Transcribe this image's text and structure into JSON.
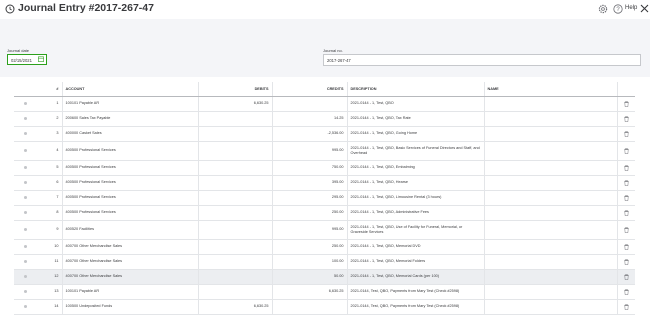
{
  "header": {
    "title": "Journal Entry #2017-267-47",
    "help_label": "Help"
  },
  "form": {
    "date_label": "Journal date",
    "date_value": "02/15/2021",
    "jno_label": "Journal no.",
    "jno_value": "2017-267-47"
  },
  "table": {
    "columns": [
      "#",
      "ACCOUNT",
      "DEBITS",
      "CREDITS",
      "DESCRIPTION",
      "NAME"
    ],
    "rows": [
      {
        "num": "1",
        "account": "100101 Payable AR",
        "debit": "6,630.25",
        "credit": "",
        "description": "2021-0144 - 1, Test, QBO",
        "name": ""
      },
      {
        "num": "2",
        "account": "200600 Sales Tax Payable",
        "debit": "",
        "credit": "14.25",
        "description": "2021-0144 - 1, Test, QBO, Tax Rate",
        "name": ""
      },
      {
        "num": "3",
        "account": "400000 Casket Sales",
        "debit": "",
        "credit": "-2,536.00",
        "description": "2021-0144 - 1, Test, QBO, Going Home",
        "name": ""
      },
      {
        "num": "4",
        "account": "400500 Professional Services",
        "debit": "",
        "credit": "995.00",
        "description": "2021-0144 - 1, Test, QBO, Basic Services of Funeral Directors and Staff, and Overhead",
        "name": ""
      },
      {
        "num": "5",
        "account": "400500 Professional Services",
        "debit": "",
        "credit": "750.00",
        "description": "2021-0144 - 1, Test, QBO, Embalming",
        "name": ""
      },
      {
        "num": "6",
        "account": "400500 Professional Services",
        "debit": "",
        "credit": "395.00",
        "description": "2021-0144 - 1, Test, QBO, Hearse",
        "name": ""
      },
      {
        "num": "7",
        "account": "400500 Professional Services",
        "debit": "",
        "credit": "295.00",
        "description": "2021-0144 - 1, Test, QBO, Limousine Rental (3 hours)",
        "name": ""
      },
      {
        "num": "8",
        "account": "400500 Professional Services",
        "debit": "",
        "credit": "250.00",
        "description": "2021-0144 - 1, Test, QBO, Administrative Fees",
        "name": ""
      },
      {
        "num": "9",
        "account": "400520 Facilities",
        "debit": "",
        "credit": "995.00",
        "description": "2021-0144 - 1, Test, QBO, Use of Facility for Funeral, Memorial, or Graveside Services",
        "name": ""
      },
      {
        "num": "10",
        "account": "400700 Other Merchandise Sales",
        "debit": "",
        "credit": "250.00",
        "description": "2021-0144 - 1, Test, QBO, Memorial DVD",
        "name": ""
      },
      {
        "num": "11",
        "account": "400700 Other Merchandise Sales",
        "debit": "",
        "credit": "100.00",
        "description": "2021-0144 - 1, Test, QBO, Memorial Folders",
        "name": ""
      },
      {
        "num": "12",
        "account": "400700 Other Merchandise Sales",
        "debit": "",
        "credit": "50.00",
        "description": "2021-0144 - 1, Test, QBO, Memorial Cards (per 100)",
        "name": ""
      },
      {
        "num": "13",
        "account": "100101 Payable AR",
        "debit": "",
        "credit": "6,630.25",
        "description": "2021-0144, Test, QBO, Payments from Mary Test (Check #2598)",
        "name": ""
      },
      {
        "num": "14",
        "account": "100500 Undeposited Funds",
        "debit": "6,630.25",
        "credit": "",
        "description": "2021-0144, Test, QBO, Payments from Mary Test (Check #2598)",
        "name": ""
      }
    ]
  }
}
